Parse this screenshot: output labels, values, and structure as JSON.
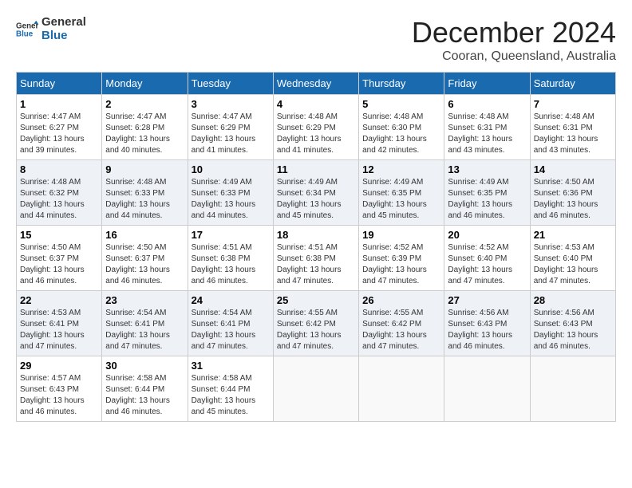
{
  "logo": {
    "general": "General",
    "blue": "Blue"
  },
  "title": "December 2024",
  "location": "Cooran, Queensland, Australia",
  "days_of_week": [
    "Sunday",
    "Monday",
    "Tuesday",
    "Wednesday",
    "Thursday",
    "Friday",
    "Saturday"
  ],
  "weeks": [
    [
      {
        "day": "1",
        "sunrise": "4:47 AM",
        "sunset": "6:27 PM",
        "daylight": "13 hours and 39 minutes."
      },
      {
        "day": "2",
        "sunrise": "4:47 AM",
        "sunset": "6:28 PM",
        "daylight": "13 hours and 40 minutes."
      },
      {
        "day": "3",
        "sunrise": "4:47 AM",
        "sunset": "6:29 PM",
        "daylight": "13 hours and 41 minutes."
      },
      {
        "day": "4",
        "sunrise": "4:48 AM",
        "sunset": "6:29 PM",
        "daylight": "13 hours and 41 minutes."
      },
      {
        "day": "5",
        "sunrise": "4:48 AM",
        "sunset": "6:30 PM",
        "daylight": "13 hours and 42 minutes."
      },
      {
        "day": "6",
        "sunrise": "4:48 AM",
        "sunset": "6:31 PM",
        "daylight": "13 hours and 43 minutes."
      },
      {
        "day": "7",
        "sunrise": "4:48 AM",
        "sunset": "6:31 PM",
        "daylight": "13 hours and 43 minutes."
      }
    ],
    [
      {
        "day": "8",
        "sunrise": "4:48 AM",
        "sunset": "6:32 PM",
        "daylight": "13 hours and 44 minutes."
      },
      {
        "day": "9",
        "sunrise": "4:48 AM",
        "sunset": "6:33 PM",
        "daylight": "13 hours and 44 minutes."
      },
      {
        "day": "10",
        "sunrise": "4:49 AM",
        "sunset": "6:33 PM",
        "daylight": "13 hours and 44 minutes."
      },
      {
        "day": "11",
        "sunrise": "4:49 AM",
        "sunset": "6:34 PM",
        "daylight": "13 hours and 45 minutes."
      },
      {
        "day": "12",
        "sunrise": "4:49 AM",
        "sunset": "6:35 PM",
        "daylight": "13 hours and 45 minutes."
      },
      {
        "day": "13",
        "sunrise": "4:49 AM",
        "sunset": "6:35 PM",
        "daylight": "13 hours and 46 minutes."
      },
      {
        "day": "14",
        "sunrise": "4:50 AM",
        "sunset": "6:36 PM",
        "daylight": "13 hours and 46 minutes."
      }
    ],
    [
      {
        "day": "15",
        "sunrise": "4:50 AM",
        "sunset": "6:37 PM",
        "daylight": "13 hours and 46 minutes."
      },
      {
        "day": "16",
        "sunrise": "4:50 AM",
        "sunset": "6:37 PM",
        "daylight": "13 hours and 46 minutes."
      },
      {
        "day": "17",
        "sunrise": "4:51 AM",
        "sunset": "6:38 PM",
        "daylight": "13 hours and 46 minutes."
      },
      {
        "day": "18",
        "sunrise": "4:51 AM",
        "sunset": "6:38 PM",
        "daylight": "13 hours and 47 minutes."
      },
      {
        "day": "19",
        "sunrise": "4:52 AM",
        "sunset": "6:39 PM",
        "daylight": "13 hours and 47 minutes."
      },
      {
        "day": "20",
        "sunrise": "4:52 AM",
        "sunset": "6:40 PM",
        "daylight": "13 hours and 47 minutes."
      },
      {
        "day": "21",
        "sunrise": "4:53 AM",
        "sunset": "6:40 PM",
        "daylight": "13 hours and 47 minutes."
      }
    ],
    [
      {
        "day": "22",
        "sunrise": "4:53 AM",
        "sunset": "6:41 PM",
        "daylight": "13 hours and 47 minutes."
      },
      {
        "day": "23",
        "sunrise": "4:54 AM",
        "sunset": "6:41 PM",
        "daylight": "13 hours and 47 minutes."
      },
      {
        "day": "24",
        "sunrise": "4:54 AM",
        "sunset": "6:41 PM",
        "daylight": "13 hours and 47 minutes."
      },
      {
        "day": "25",
        "sunrise": "4:55 AM",
        "sunset": "6:42 PM",
        "daylight": "13 hours and 47 minutes."
      },
      {
        "day": "26",
        "sunrise": "4:55 AM",
        "sunset": "6:42 PM",
        "daylight": "13 hours and 47 minutes."
      },
      {
        "day": "27",
        "sunrise": "4:56 AM",
        "sunset": "6:43 PM",
        "daylight": "13 hours and 46 minutes."
      },
      {
        "day": "28",
        "sunrise": "4:56 AM",
        "sunset": "6:43 PM",
        "daylight": "13 hours and 46 minutes."
      }
    ],
    [
      {
        "day": "29",
        "sunrise": "4:57 AM",
        "sunset": "6:43 PM",
        "daylight": "13 hours and 46 minutes."
      },
      {
        "day": "30",
        "sunrise": "4:58 AM",
        "sunset": "6:44 PM",
        "daylight": "13 hours and 46 minutes."
      },
      {
        "day": "31",
        "sunrise": "4:58 AM",
        "sunset": "6:44 PM",
        "daylight": "13 hours and 45 minutes."
      },
      null,
      null,
      null,
      null
    ]
  ]
}
